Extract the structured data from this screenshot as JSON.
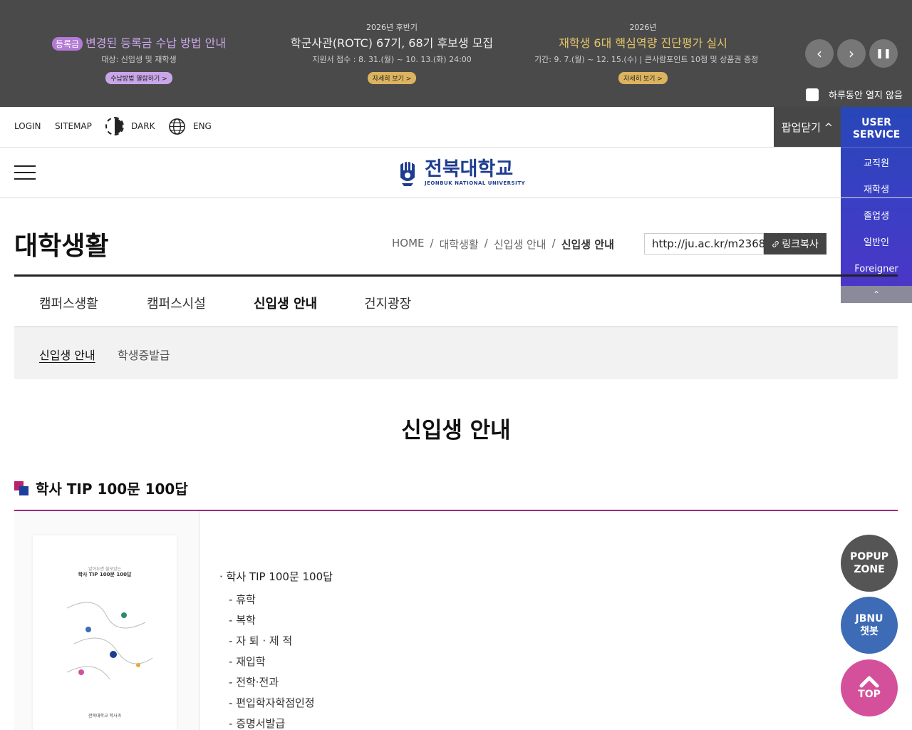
{
  "popup": {
    "items": [
      {
        "kicker": "",
        "badge": "등록금",
        "title": "변경된 등록금 수납 방법 안내",
        "sub": "대상: 신입생 및 재학생",
        "btn": "수납방법 열람하기 >"
      },
      {
        "kicker": "2026년 후반기",
        "title": "학군사관(ROTC) 67기, 68기 후보생 모집",
        "sub": "지원서 접수 : 8. 31.(월) ~ 10. 13.(화) 24:00",
        "btn": "자세히 보기 >"
      },
      {
        "kicker": "2026년",
        "title": "재학생 6대 핵심역량 진단평가 실시",
        "sub": "기간: 9. 7.(월) ~ 12. 15.(수) | 큰사람포인트 10점 및 상품권 증정",
        "btn": "자세히 보기 >"
      }
    ],
    "prev": "‹",
    "next": "›",
    "pause": "❚❚",
    "no_show_today": "하루동안 열지 않음"
  },
  "utility": {
    "login": "LOGIN",
    "sitemap": "SITEMAP",
    "dark": "DARK",
    "eng": "ENG",
    "popup_close": "팝업닫기 ^"
  },
  "user_service": {
    "title_line1": "USER",
    "title_line2": "SERVICE",
    "items": [
      "교직원",
      "재학생",
      "졸업생",
      "일반인",
      "Foreigner"
    ],
    "up": "⌃"
  },
  "logo": {
    "ko": "전북대학교",
    "en": "JEONBUK NATIONAL UNIVERSITY"
  },
  "page": {
    "title": "대학생활",
    "breadcrumb": [
      "HOME",
      "/",
      "대학생활",
      "/",
      "신입생 안내",
      "/",
      "신입생 안내"
    ],
    "url": "http://ju.ac.kr/m2368",
    "copy_btn": "링크복사"
  },
  "tabs1": [
    "캠퍼스생활",
    "캠퍼스시설",
    "신입생 안내",
    "건지광장"
  ],
  "tabs2": [
    "신입생 안내",
    "학생증발급"
  ],
  "content_title": "신입생 안내",
  "section": {
    "heading": "학사 TIP 100문 100답",
    "book_kicker": "알아두면 쓸모있는",
    "book_title": "학사 TIP 100문 100답",
    "book_footer": "전북대학교 학사과",
    "toc_main": "학사 TIP 100문 100답",
    "toc_items": [
      "휴학",
      "복학",
      "자 퇴 · 제 적",
      "재입학",
      "전학·전과",
      "편입학자학점인정",
      "증명서발급"
    ]
  },
  "floating": {
    "popup_l1": "POPUP",
    "popup_l2": "ZONE",
    "chat_l1": "JBNU",
    "chat_l2": "챗봇",
    "top": "TOP"
  },
  "colors": {
    "popup_bg": "#4a4a4a",
    "user_service": "#2f43bf",
    "accent_magenta": "#9e2a7b",
    "brand_navy": "#1e3d8f"
  }
}
